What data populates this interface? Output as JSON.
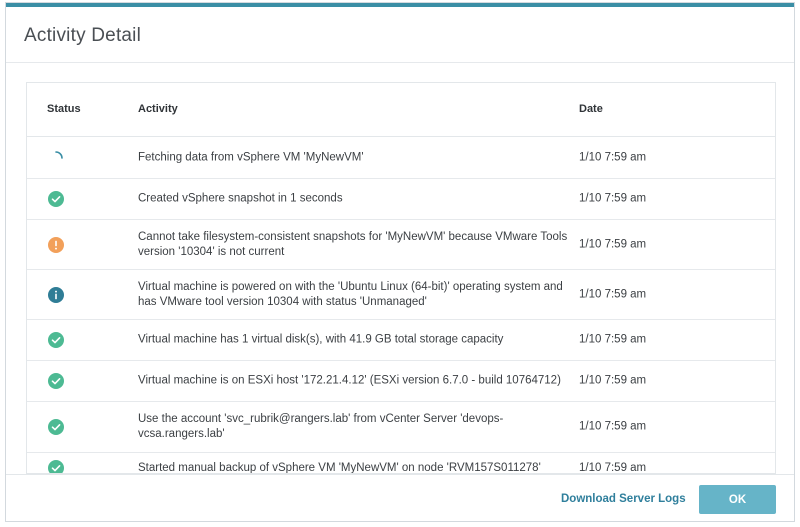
{
  "dialog": {
    "title": "Activity Detail"
  },
  "table": {
    "headers": {
      "status": "Status",
      "activity": "Activity",
      "date": "Date"
    },
    "rows": [
      {
        "status": "in-progress",
        "activity": "Fetching data from vSphere VM 'MyNewVM'",
        "date": "1/10 7:59 am"
      },
      {
        "status": "success",
        "activity": "Created vSphere snapshot in 1 seconds",
        "date": "1/10 7:59 am"
      },
      {
        "status": "warning",
        "activity": "Cannot take filesystem-consistent snapshots for 'MyNewVM' because VMware Tools version '10304' is not current",
        "date": "1/10 7:59 am"
      },
      {
        "status": "info",
        "activity": "Virtual machine is powered on with the 'Ubuntu Linux (64-bit)' operating system and has VMware tool version 10304 with status 'Unmanaged'",
        "date": "1/10 7:59 am"
      },
      {
        "status": "success",
        "activity": "Virtual machine has 1 virtual disk(s), with 41.9 GB total storage capacity",
        "date": "1/10 7:59 am"
      },
      {
        "status": "success",
        "activity": "Virtual machine is on ESXi host '172.21.4.12' (ESXi version 6.7.0 - build 10764712)",
        "date": "1/10 7:59 am"
      },
      {
        "status": "success",
        "activity": "Use the account 'svc_rubrik@rangers.lab' from vCenter Server 'devops-vcsa.rangers.lab'",
        "date": "1/10 7:59 am"
      },
      {
        "status": "success",
        "activity": "Started manual backup of vSphere VM 'MyNewVM' on node 'RVM157S011278'",
        "date": "1/10 7:59 am"
      }
    ]
  },
  "footer": {
    "download_logs_label": "Download Server Logs",
    "ok_label": "OK"
  },
  "colors": {
    "accent": "#3a8ea5",
    "success": "#4dba93",
    "warning": "#f2a05a",
    "info": "#2f7d96",
    "ok_button": "#66b4c8"
  }
}
